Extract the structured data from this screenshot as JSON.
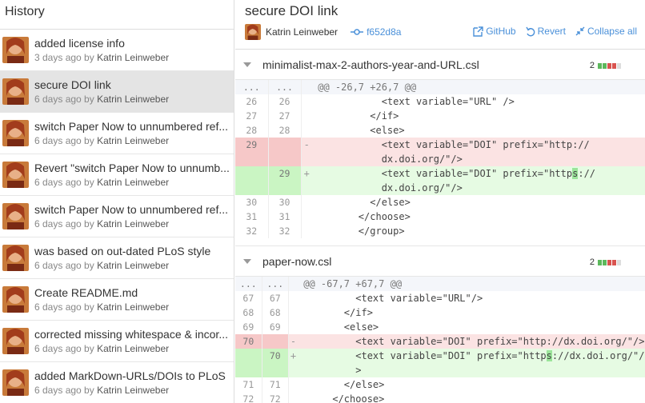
{
  "sidebar": {
    "title": "History",
    "commits": [
      {
        "title": "added license info",
        "time": "3 days ago",
        "by": "by",
        "author": "Katrin Leinweber"
      },
      {
        "title": "secure DOI link",
        "time": "6 days ago",
        "by": "by",
        "author": "Katrin Leinweber"
      },
      {
        "title": "switch Paper Now to unnumbered ref...",
        "time": "6 days ago",
        "by": "by",
        "author": "Katrin Leinweber"
      },
      {
        "title": "Revert \"switch Paper Now to unnumb...",
        "time": "6 days ago",
        "by": "by",
        "author": "Katrin Leinweber"
      },
      {
        "title": "switch Paper Now to unnumbered ref...",
        "time": "6 days ago",
        "by": "by",
        "author": "Katrin Leinweber"
      },
      {
        "title": "was based on out-dated PLoS style",
        "time": "6 days ago",
        "by": "by",
        "author": "Katrin Leinweber"
      },
      {
        "title": "Create README.md",
        "time": "6 days ago",
        "by": "by",
        "author": "Katrin Leinweber"
      },
      {
        "title": "corrected missing whitespace & incor...",
        "time": "6 days ago",
        "by": "by",
        "author": "Katrin Leinweber"
      },
      {
        "title": "added MarkDown-URLs/DOIs to PLoS",
        "time": "6 days ago",
        "by": "by",
        "author": "Katrin Leinweber"
      }
    ]
  },
  "commit": {
    "title": "secure DOI link",
    "author": "Katrin Leinweber",
    "sha": "f652d8a",
    "actions": {
      "github": "GitHub",
      "revert": "Revert",
      "collapse": "Collapse all"
    }
  },
  "files": [
    {
      "name": "minimalist-max-2-authors-year-and-URL.csl",
      "changes": "2",
      "hunk": "@@ -26,7 +26,7 @@",
      "hunk_dots": "...",
      "lines": [
        {
          "old": "26",
          "new": "26",
          "sign": "",
          "code": "            <text variable=\"URL\" />"
        },
        {
          "old": "27",
          "new": "27",
          "sign": "",
          "code": "          </if>"
        },
        {
          "old": "28",
          "new": "28",
          "sign": "",
          "code": "          <else>"
        },
        {
          "old": "29",
          "new": "",
          "sign": "-",
          "code": "            <text variable=\"DOI\" prefix=\"http://"
        },
        {
          "old": "",
          "new": "",
          "sign": "",
          "code": "            dx.doi.org/\"/>"
        },
        {
          "old": "",
          "new": "29",
          "sign": "+",
          "code_a": "            <text variable=\"DOI\" prefix=\"http",
          "code_hl": "s",
          "code_b": "://"
        },
        {
          "old": "",
          "new": "",
          "sign": "",
          "code": "            dx.doi.org/\"/>"
        },
        {
          "old": "30",
          "new": "30",
          "sign": "",
          "code": "          </else>"
        },
        {
          "old": "31",
          "new": "31",
          "sign": "",
          "code": "        </choose>"
        },
        {
          "old": "32",
          "new": "32",
          "sign": "",
          "code": "        </group>"
        }
      ]
    },
    {
      "name": "paper-now.csl",
      "changes": "2",
      "hunk": "@@ -67,7 +67,7 @@",
      "hunk_dots": "...",
      "lines": [
        {
          "old": "67",
          "new": "67",
          "sign": "",
          "code": "          <text variable=\"URL\"/>"
        },
        {
          "old": "68",
          "new": "68",
          "sign": "",
          "code": "        </if>"
        },
        {
          "old": "69",
          "new": "69",
          "sign": "",
          "code": "        <else>"
        },
        {
          "old": "70",
          "new": "",
          "sign": "-",
          "code": "          <text variable=\"DOI\" prefix=\"http://dx.doi.org/\"/>"
        },
        {
          "old": "",
          "new": "70",
          "sign": "+",
          "code_a": "          <text variable=\"DOI\" prefix=\"http",
          "code_hl": "s",
          "code_b": "://dx.doi.org/\"/"
        },
        {
          "old": "",
          "new": "",
          "sign": "",
          "code": "          >"
        },
        {
          "old": "71",
          "new": "71",
          "sign": "",
          "code": "        </else>"
        },
        {
          "old": "72",
          "new": "72",
          "sign": "",
          "code": "      </choose>"
        }
      ]
    }
  ],
  "colors": {
    "accent": "#4a90d9",
    "added": "#e6fbe3",
    "deleted": "#fbe3e3",
    "selected": "#e4e4e4"
  }
}
